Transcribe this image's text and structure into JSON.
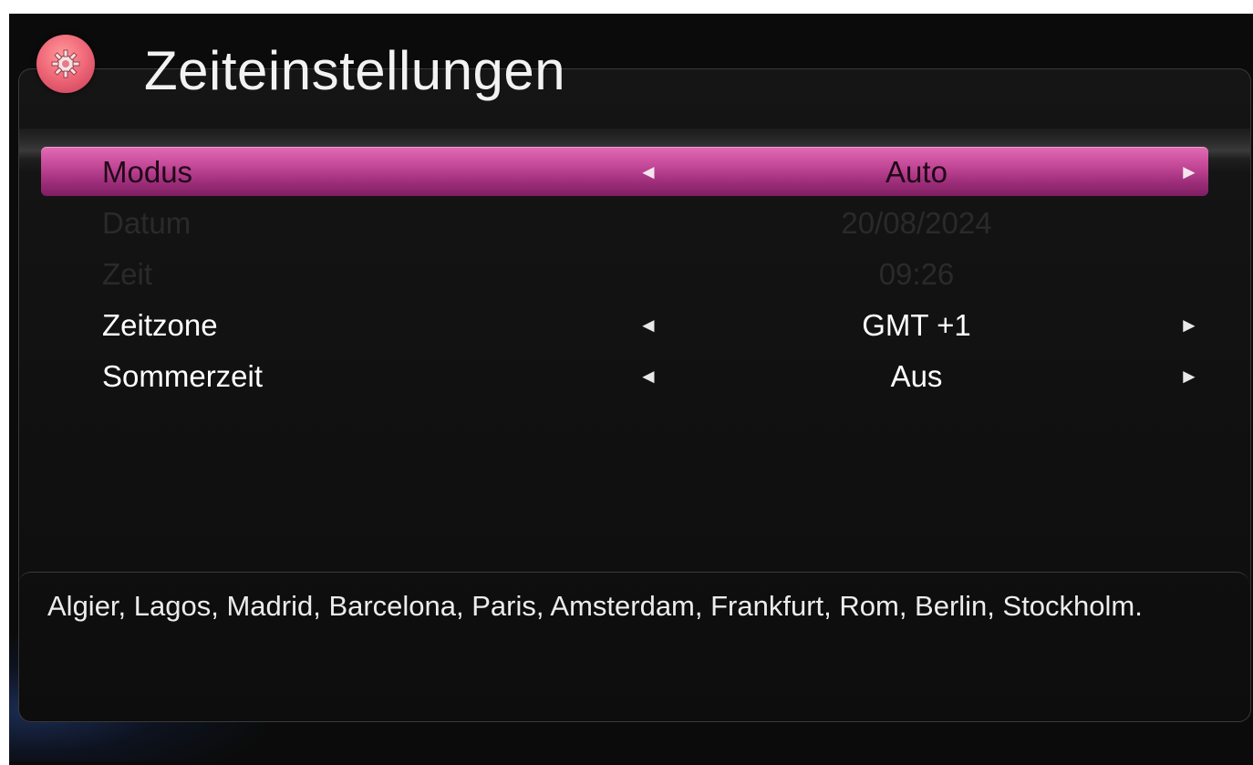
{
  "header": {
    "title": "Zeiteinstellungen",
    "icon": "gear-icon"
  },
  "menu": {
    "rows": [
      {
        "label": "Modus",
        "value": "Auto",
        "selected": true,
        "enabled": true
      },
      {
        "label": "Datum",
        "value": "20/08/2024",
        "selected": false,
        "enabled": false
      },
      {
        "label": "Zeit",
        "value": "09:26",
        "selected": false,
        "enabled": false
      },
      {
        "label": "Zeitzone",
        "value": "GMT +1",
        "selected": false,
        "enabled": true
      },
      {
        "label": "Sommerzeit",
        "value": "Aus",
        "selected": false,
        "enabled": true
      }
    ]
  },
  "info": {
    "text": "Algier, Lagos, Madrid, Barcelona, Paris, Amsterdam, Frankfurt, Rom, Berlin, Stockholm."
  },
  "colors": {
    "selection": "#c24797",
    "icon": "#f06a7a",
    "text": "#ffffff",
    "disabled_text": "#2a2a2a"
  }
}
